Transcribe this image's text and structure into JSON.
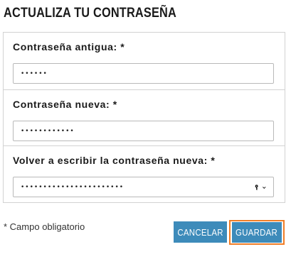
{
  "page": {
    "title": "ACTUALIZA TU CONTRASEÑA"
  },
  "form": {
    "old_password": {
      "label": "Contraseña antigua: *",
      "value": "••••••"
    },
    "new_password": {
      "label": "Contraseña nueva: *",
      "value": "••••••••••••"
    },
    "confirm_password": {
      "label": "Volver a escribir la contraseña nueva: *",
      "value": "•••••••••••••••••••••••",
      "key_icon": "key-icon",
      "dropdown_icon": "chevron-down-icon"
    },
    "required_note": "* Campo obligatorio"
  },
  "actions": {
    "cancel_label": "CANCELAR",
    "save_label": "GUARDAR"
  },
  "colors": {
    "button_bg": "#3d8bba",
    "focus_ring": "#f07d26",
    "border": "#d2d2d2"
  }
}
